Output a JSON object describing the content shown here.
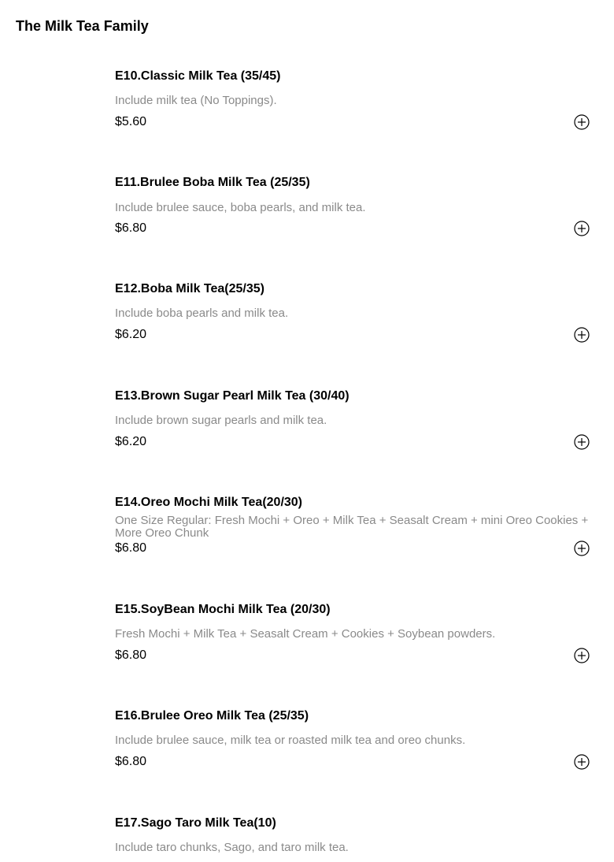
{
  "category": {
    "title": "The Milk Tea Family"
  },
  "items": [
    {
      "name": "E10.Classic Milk Tea (35/45)",
      "description": "Include milk tea (No Toppings).",
      "price": "$5.60",
      "add_icon": "plus-circle-icon"
    },
    {
      "name": "E11.Brulee Boba Milk Tea (25/35)",
      "description": "Include brulee sauce, boba pearls, and milk tea.",
      "price": "$6.80",
      "add_icon": "plus-circle-icon"
    },
    {
      "name": "E12.Boba Milk Tea(25/35)",
      "description": "Include boba pearls and milk tea.",
      "price": "$6.20",
      "add_icon": "plus-circle-icon"
    },
    {
      "name": "E13.Brown Sugar Pearl Milk Tea (30/40)",
      "description": "Include brown sugar pearls and milk tea.",
      "price": "$6.20",
      "add_icon": "plus-circle-icon"
    },
    {
      "name": "E14.Oreo Mochi Milk Tea(20/30)",
      "description": "One Size Regular: Fresh Mochi + Oreo + Milk Tea + Seasalt Cream + mini Oreo Cookies + More Oreo Chunk",
      "price": "$6.80",
      "add_icon": "plus-circle-icon"
    },
    {
      "name": "E15.SoyBean Mochi Milk Tea (20/30)",
      "description": "Fresh Mochi + Milk Tea + Seasalt Cream + Cookies + Soybean powders.",
      "price": "$6.80",
      "add_icon": "plus-circle-icon"
    },
    {
      "name": "E16.Brulee Oreo Milk Tea (25/35)",
      "description": "Include brulee sauce, milk tea or roasted milk tea and oreo chunks.",
      "price": "$6.80",
      "add_icon": "plus-circle-icon"
    },
    {
      "name": "E17.Sago Taro Milk Tea(10)",
      "description": "Include taro chunks, Sago, and taro milk tea.",
      "price": "",
      "add_icon": "plus-circle-icon"
    }
  ]
}
